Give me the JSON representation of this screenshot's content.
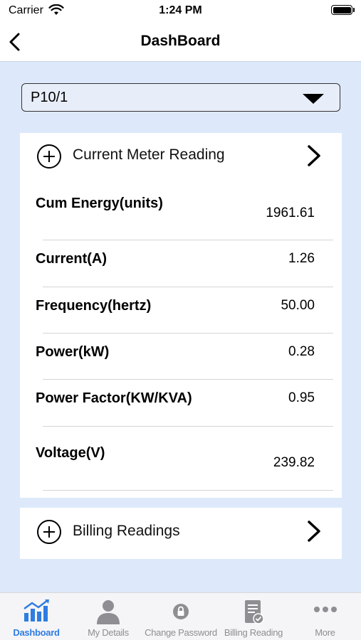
{
  "status": {
    "carrier": "Carrier",
    "time": "1:24 PM"
  },
  "nav": {
    "title": "DashBoard"
  },
  "selector": {
    "value": "P10/1"
  },
  "current_reading": {
    "title": "Current Meter Reading",
    "rows": [
      {
        "label": "Cum Energy(units)",
        "value": "1961.61"
      },
      {
        "label": "Current(A)",
        "value": "1.26"
      },
      {
        "label": "Frequency(hertz)",
        "value": "50.00"
      },
      {
        "label": "Power(kW)",
        "value": "0.28"
      },
      {
        "label": "Power Factor(KW/KVA)",
        "value": "0.95"
      },
      {
        "label": "Voltage(V)",
        "value": "239.82"
      }
    ]
  },
  "billing": {
    "title": "Billing Readings"
  },
  "tabs": [
    {
      "label": "Dashboard",
      "icon": "chart-icon",
      "active": true
    },
    {
      "label": "My Details",
      "icon": "person-icon",
      "active": false
    },
    {
      "label": "Change Password",
      "icon": "lock-icon",
      "active": false
    },
    {
      "label": "Billing Reading",
      "icon": "bill-icon",
      "active": false
    },
    {
      "label": "More",
      "icon": "more-icon",
      "active": false
    }
  ],
  "colors": {
    "accent": "#2f7de1",
    "background": "#dde9fb",
    "inactive": "#8e8e93"
  }
}
